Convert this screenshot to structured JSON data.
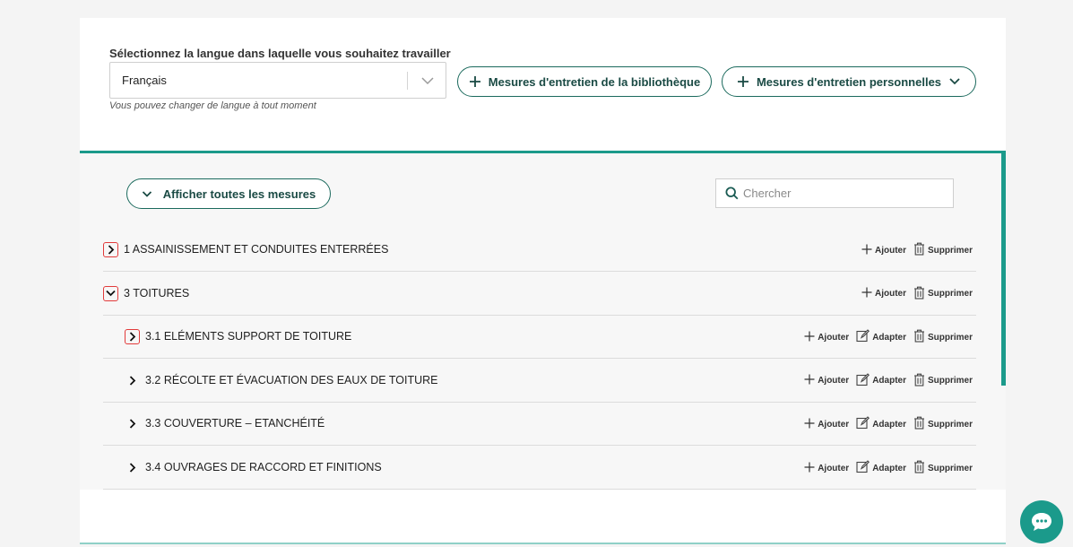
{
  "language": {
    "label": "Sélectionnez la langue dans laquelle vous souhaitez travailler",
    "value": "Français",
    "hint": "Vous pouvez changer de langue à tout moment"
  },
  "buttons": {
    "library": "Mesures d'entretien de la bibliothèque",
    "personal": "Mesures d'entretien personnelles",
    "show_all": "Afficher toutes les mesures"
  },
  "search": {
    "placeholder": "Chercher"
  },
  "actions": {
    "add": "Ajouter",
    "adapt": "Adapter",
    "delete": "Supprimer"
  },
  "rows": [
    {
      "title": "1 ASSAINISSEMENT ET CONDUITES ENTERRÉES",
      "state": "collapsed",
      "highlighted": true,
      "adapt": false
    },
    {
      "title": "3 TOITURES",
      "state": "expanded",
      "highlighted": true,
      "adapt": false
    },
    {
      "title": "3.1 ELÉMENTS SUPPORT DE TOITURE",
      "state": "collapsed",
      "highlighted": true,
      "adapt": true
    },
    {
      "title": "3.2 RÉCOLTE ET ÉVACUATION DES EAUX DE TOITURE",
      "state": "collapsed",
      "highlighted": false,
      "adapt": true
    },
    {
      "title": "3.3 COUVERTURE – ETANCHÉITÉ",
      "state": "collapsed",
      "highlighted": false,
      "adapt": true
    },
    {
      "title": "3.4 OUVRAGES DE RACCORD ET FINITIONS",
      "state": "collapsed",
      "highlighted": false,
      "adapt": true
    }
  ],
  "colors": {
    "accent": "#1b9a8b",
    "button_border": "#1b6a5d",
    "highlight": "#e23b3b"
  },
  "icons": {
    "chat": "chat-bubble-icon",
    "search": "search-icon",
    "add": "plus-icon",
    "adapt": "edit-icon",
    "delete": "trash-icon"
  }
}
